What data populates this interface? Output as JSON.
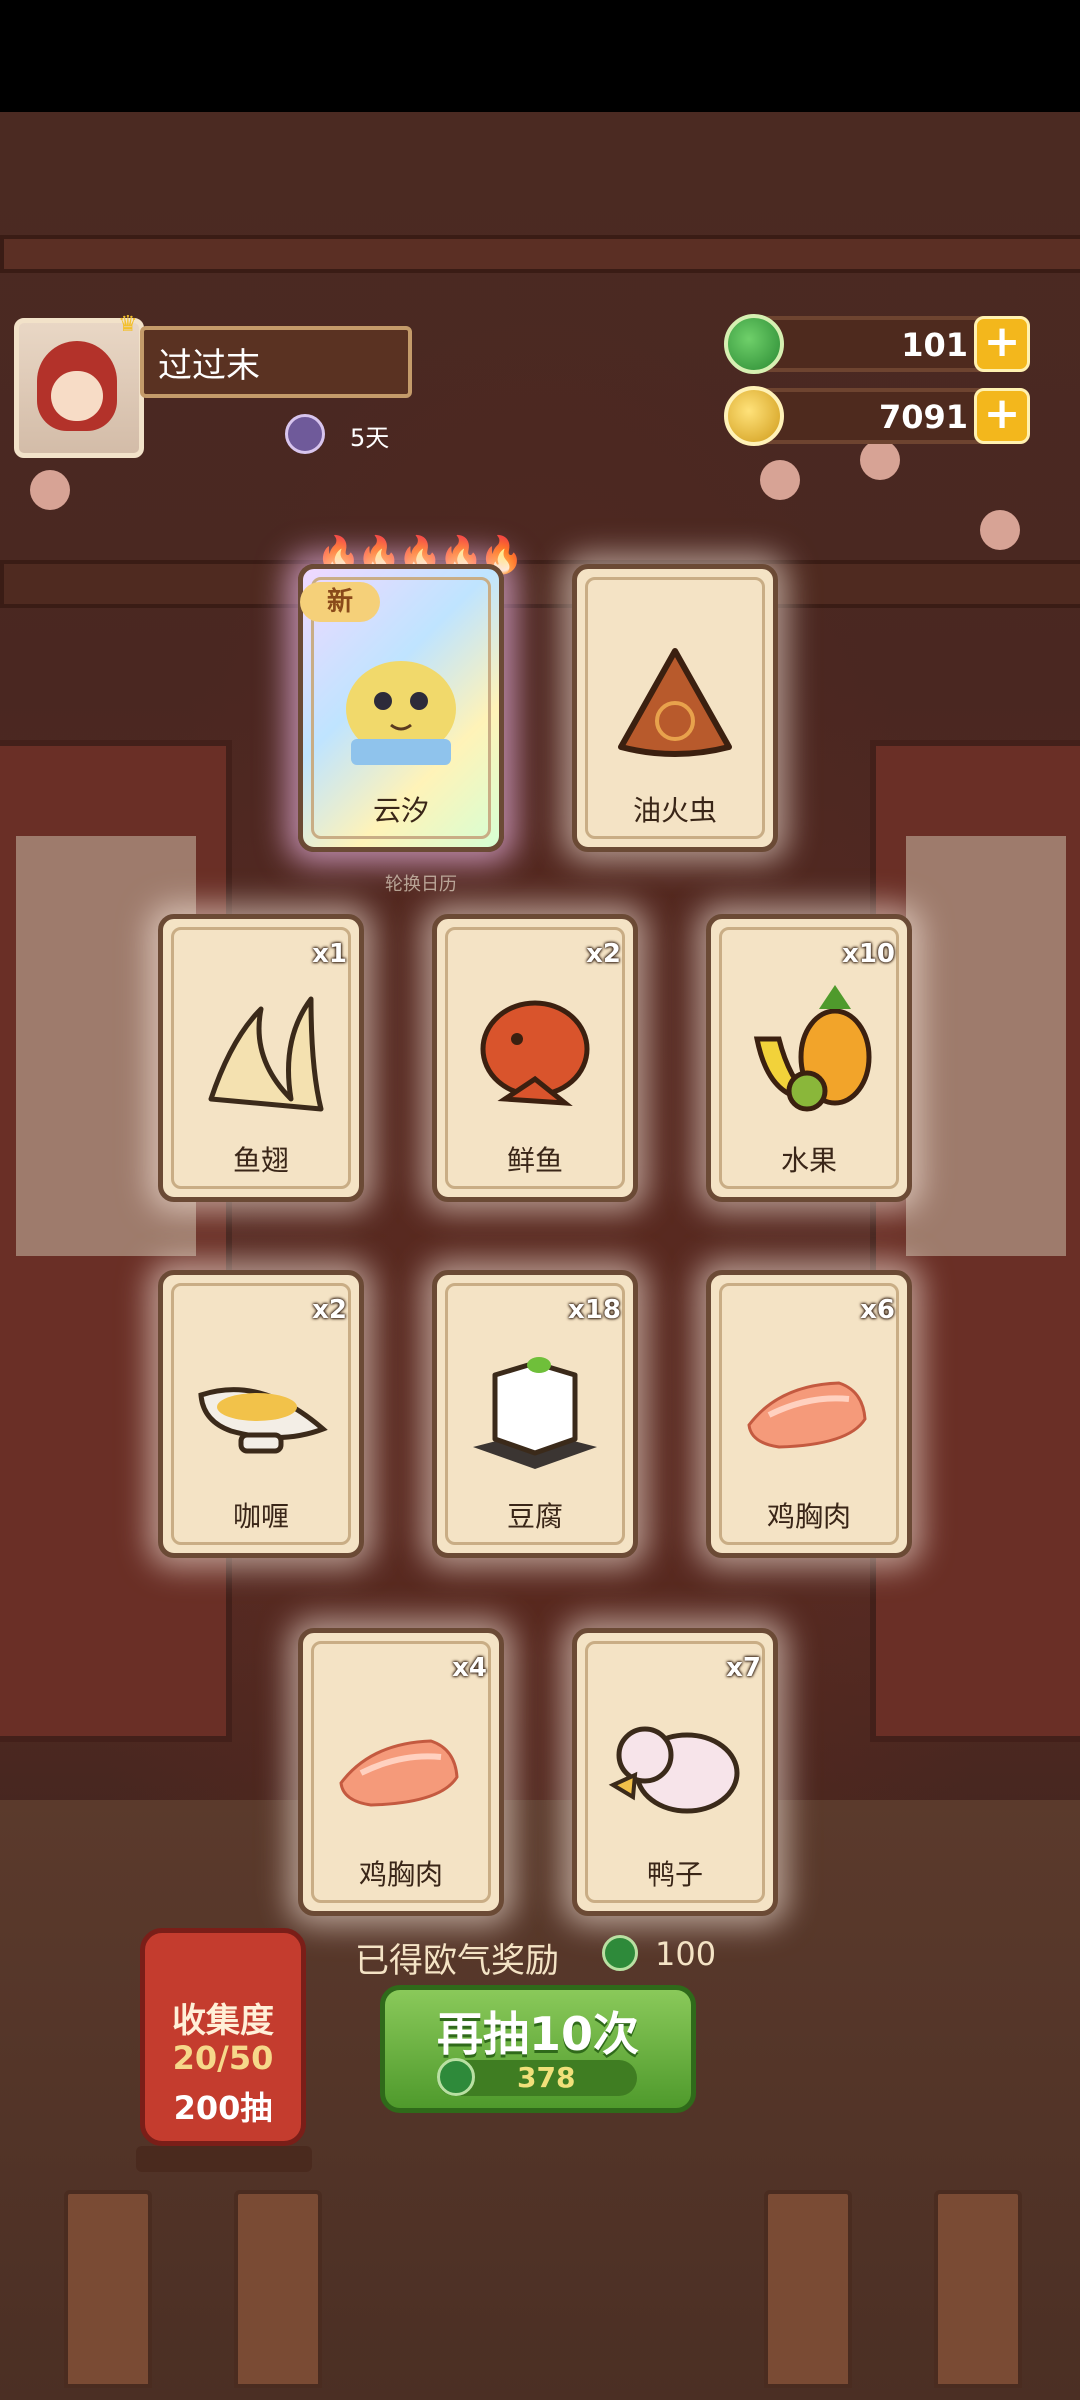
{
  "profile": {
    "name": "过过末",
    "days": "5天"
  },
  "currency": [
    {
      "icon": "jade-coin-icon",
      "value": "101"
    },
    {
      "icon": "gold-coin-icon",
      "value": "7091"
    }
  ],
  "featured_cards": [
    {
      "label": "云汐",
      "tag": "新",
      "rarity_flames": 5
    },
    {
      "label": "油火虫"
    }
  ],
  "calendar_label": "轮换日历",
  "cards": [
    {
      "label": "鱼翅",
      "count": "x1",
      "icon": "shark-fin-icon"
    },
    {
      "label": "鲜鱼",
      "count": "x2",
      "icon": "fish-icon"
    },
    {
      "label": "水果",
      "count": "x10",
      "icon": "fruit-icon"
    },
    {
      "label": "咖喱",
      "count": "x2",
      "icon": "curry-icon"
    },
    {
      "label": "豆腐",
      "count": "x18",
      "icon": "tofu-icon"
    },
    {
      "label": "鸡胸肉",
      "count": "x6",
      "icon": "chicken-breast-icon"
    },
    {
      "label": "鸡胸肉",
      "count": "x4",
      "icon": "chicken-breast-icon"
    },
    {
      "label": "鸭子",
      "count": "x7",
      "icon": "duck-icon"
    }
  ],
  "reward": {
    "label": "已得欧气奖励",
    "value": "100"
  },
  "collection": {
    "title": "收集度",
    "progress": "20/50",
    "draws": "200抽"
  },
  "draw_button": {
    "label": "再抽10次",
    "cost": "378"
  }
}
